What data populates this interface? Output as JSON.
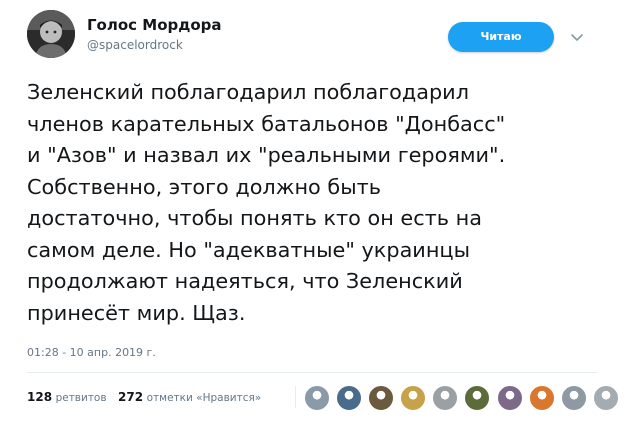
{
  "author": {
    "display_name": "Голос Мордора",
    "handle": "@spacelordrock",
    "avatar_icon": "user-avatar-photo"
  },
  "follow_button": {
    "label": "Читаю",
    "color": "#1da1f2"
  },
  "caret_icon": "chevron-down-icon",
  "tweet": {
    "lines": [
      "Зеленский поблагодарил поблагодарил",
      "членов карательных батальонов \"Донбасс\"",
      "и \"Азов\" и назвал их \"реальными героями\".",
      "Собственно, этого должно быть",
      "достаточно, чтобы понять кто он есть на",
      "самом деле. Но \"адекватные\" украинцы",
      "продолжают надеяться, что Зеленский",
      "принесёт мир. Щаз."
    ],
    "timestamp": "01:28 - 10 апр. 2019 г."
  },
  "stats": {
    "retweets_count": "128",
    "retweets_label": "ретвитов",
    "likes_count": "272",
    "likes_label": "отметки «Нравится»"
  },
  "likers": [
    {
      "icon": "liker-avatar-1",
      "color": "#8a9aa8"
    },
    {
      "icon": "liker-avatar-2",
      "color": "#4a6b8c"
    },
    {
      "icon": "liker-avatar-3",
      "color": "#6b5a3e"
    },
    {
      "icon": "liker-avatar-4",
      "color": "#c7a24a"
    },
    {
      "icon": "liker-avatar-5",
      "color": "#9aa0a4"
    },
    {
      "icon": "liker-avatar-6",
      "color": "#5c6b3a"
    },
    {
      "icon": "liker-avatar-7",
      "color": "#7d6a8a"
    },
    {
      "icon": "liker-avatar-8",
      "color": "#d9772f"
    },
    {
      "icon": "liker-avatar-9",
      "color": "#8e99a3"
    },
    {
      "icon": "liker-avatar-10",
      "color": "#a3abb3"
    }
  ]
}
